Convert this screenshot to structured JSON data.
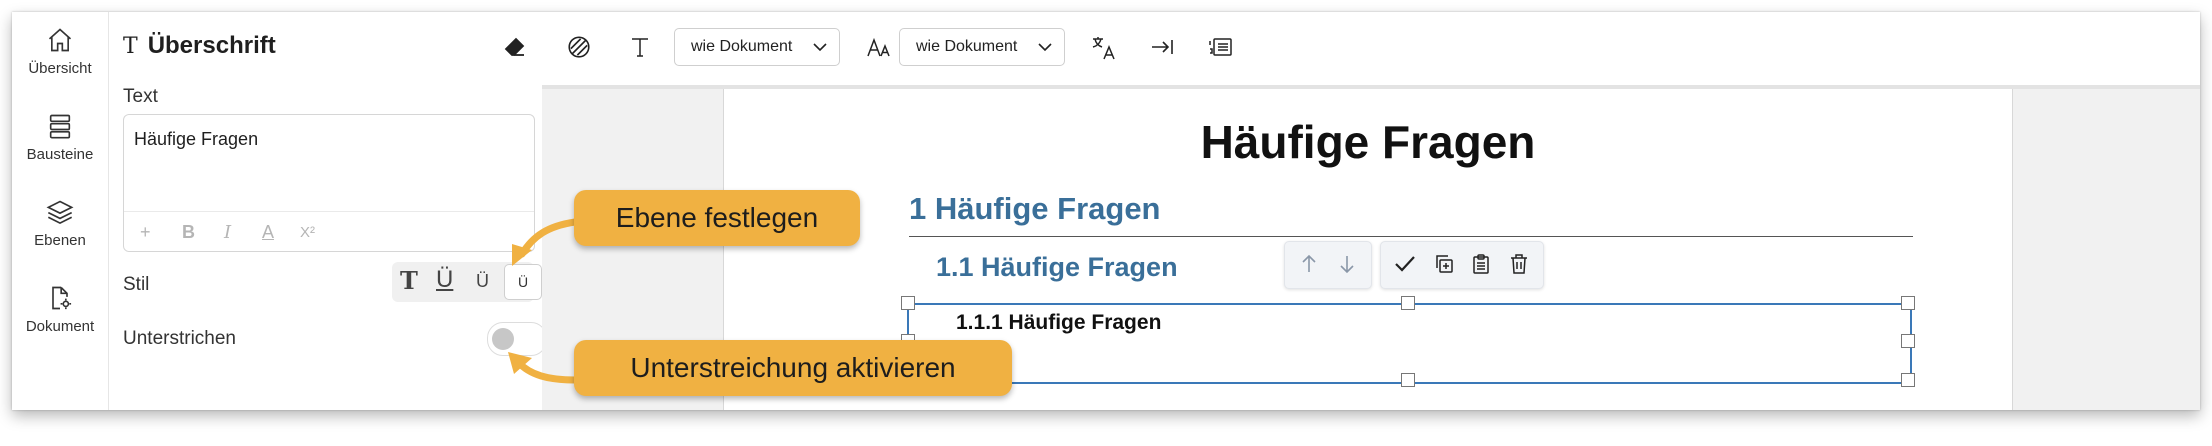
{
  "nav": {
    "items": [
      {
        "label": "Übersicht",
        "icon": "home-icon"
      },
      {
        "label": "Bausteine",
        "icon": "blocks-icon"
      },
      {
        "label": "Ebenen",
        "icon": "layers-icon"
      },
      {
        "label": "Dokument",
        "icon": "document-settings-icon"
      }
    ]
  },
  "panel": {
    "title_icon": "T",
    "title": "Überschrift",
    "text_label": "Text",
    "text_value": "Häufige Fragen",
    "format_buttons": [
      "+",
      "B",
      "I",
      "A",
      "X²"
    ],
    "style_label": "Stil",
    "style_options": [
      "T",
      "Ü",
      "Ü",
      "Ü"
    ],
    "underline_label": "Unterstrichen",
    "underline_enabled": false
  },
  "toolbar": {
    "font_select": "wie Dokument",
    "size_select": "wie Dokument"
  },
  "document": {
    "title": "Häufige Fragen",
    "h1": "1 Häufige Fragen",
    "h2": "1.1 Häufige Fragen",
    "h3": "1.1.1 Häufige Fragen"
  },
  "callouts": {
    "level": "Ebene festlegen",
    "underline": "Unterstreichung aktivieren"
  },
  "colors": {
    "accent": "#3a78b8",
    "heading_blue": "#3a6f99",
    "callout": "#f0b142"
  }
}
